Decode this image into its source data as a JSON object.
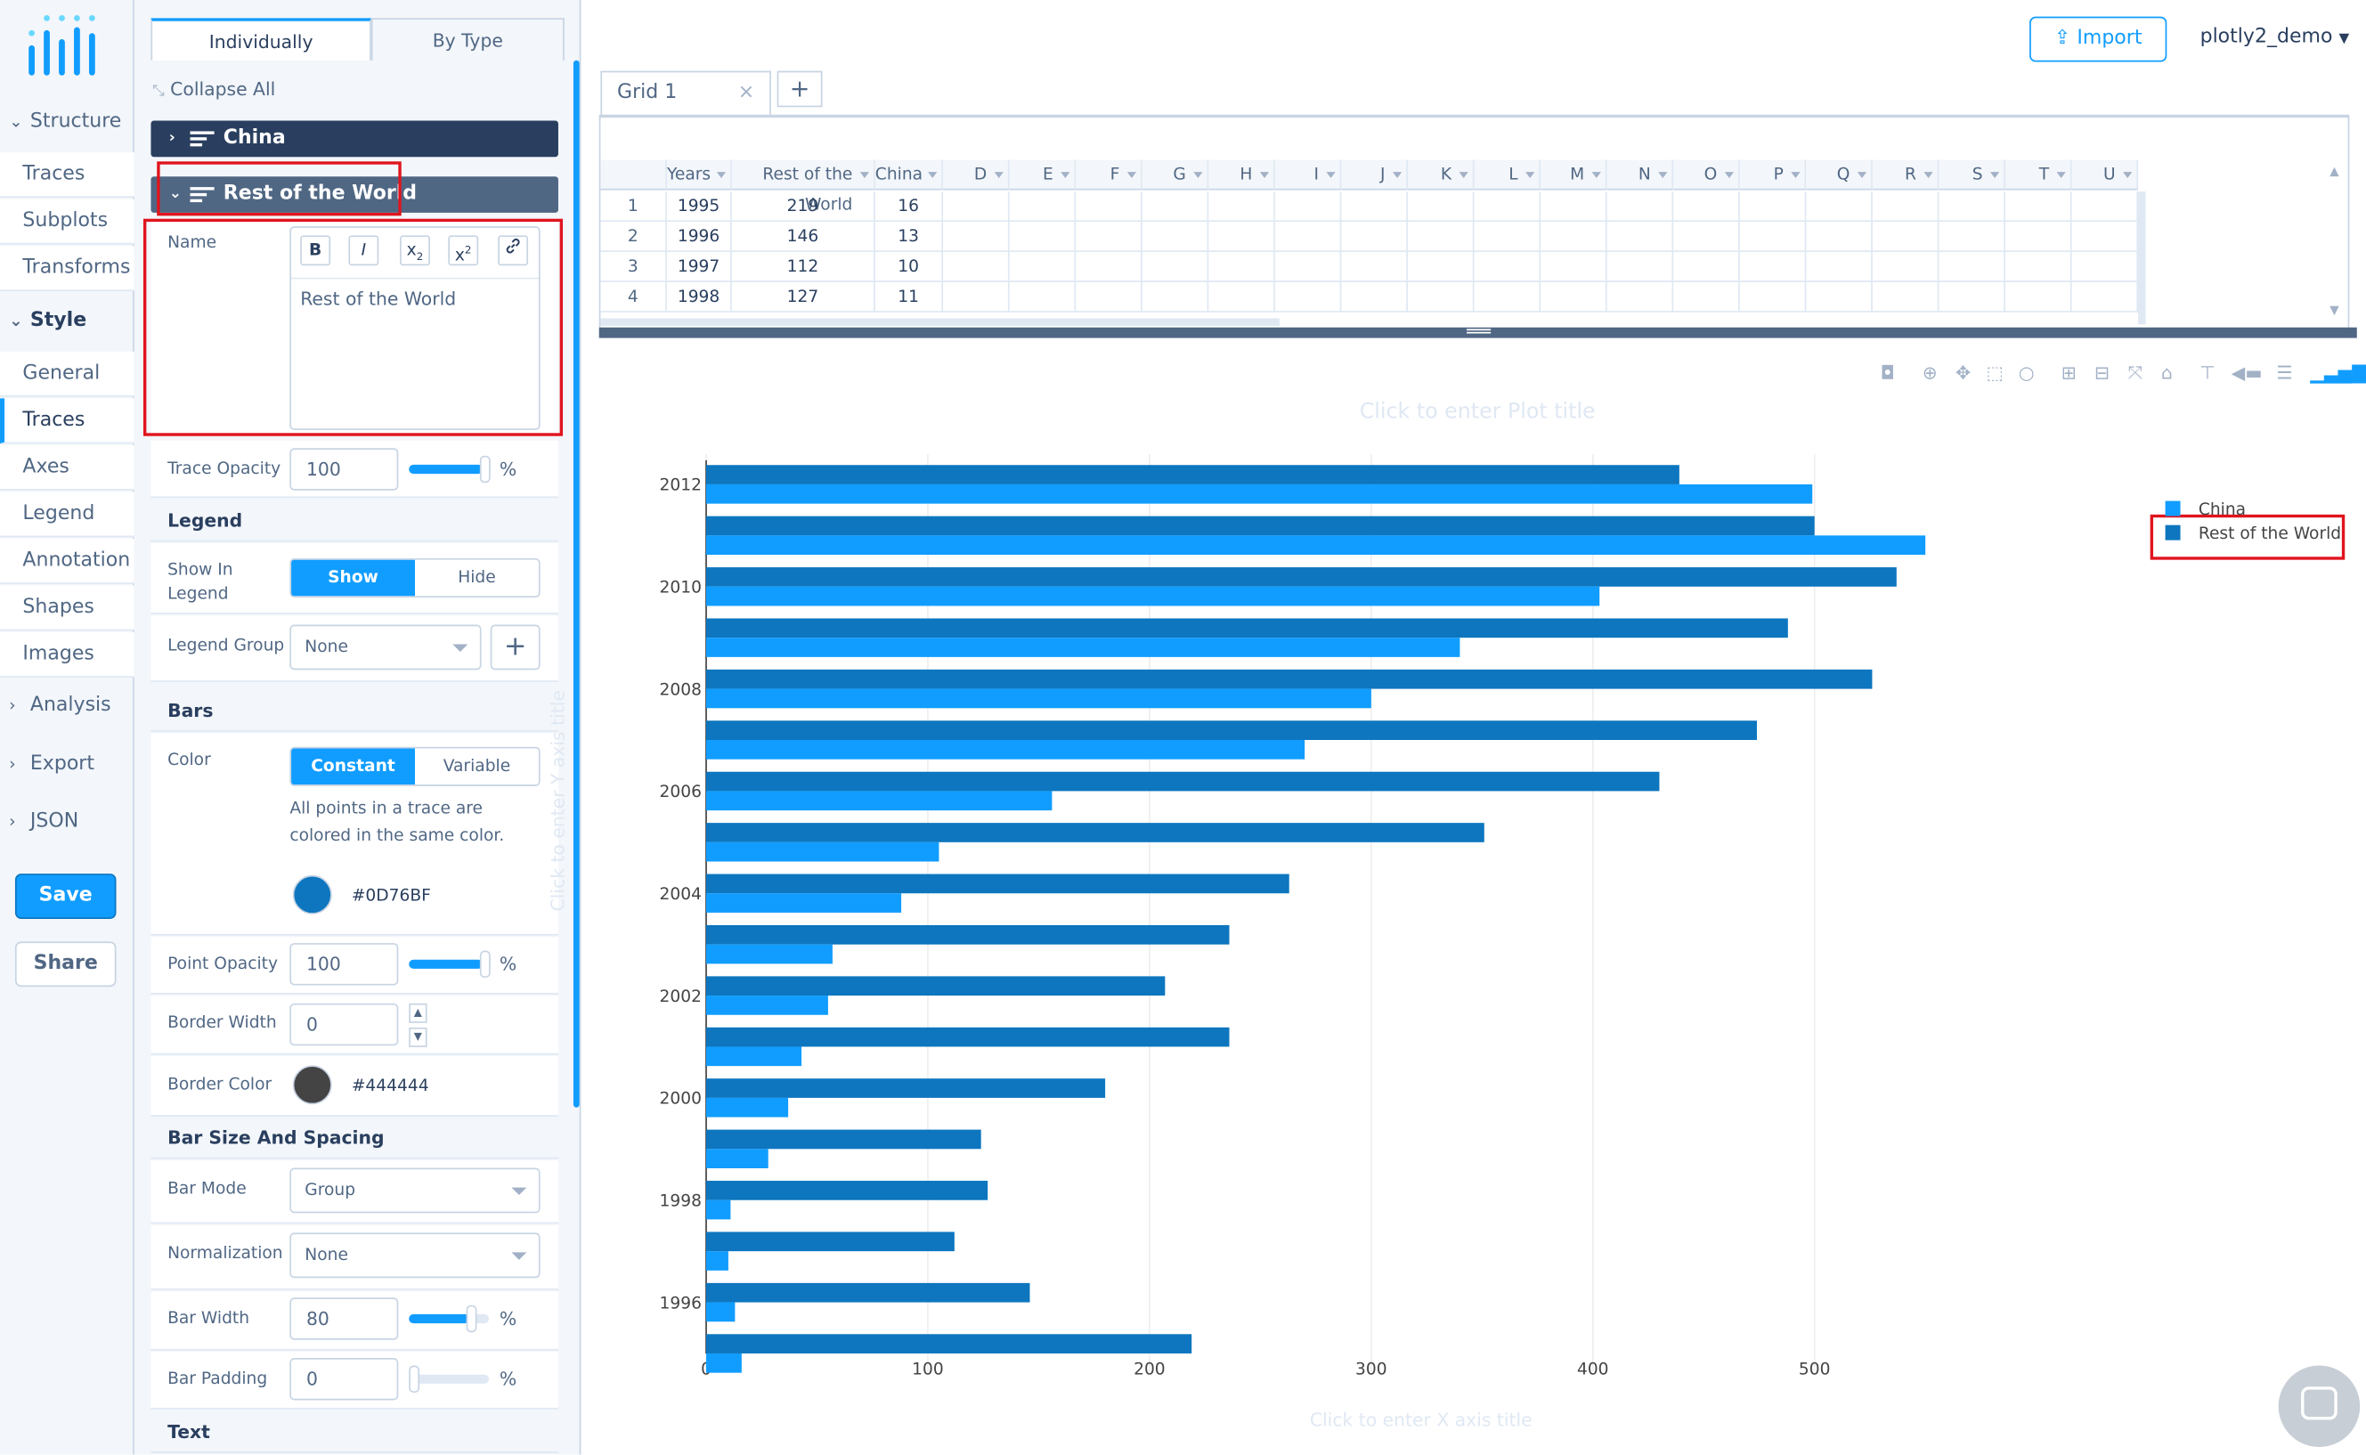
{
  "left_nav": {
    "structure_label": "Structure",
    "structure_items": [
      {
        "label": "Traces"
      },
      {
        "label": "Subplots"
      },
      {
        "label": "Transforms"
      }
    ],
    "style_label": "Style",
    "style_items": [
      {
        "label": "General"
      },
      {
        "label": "Traces"
      },
      {
        "label": "Axes"
      },
      {
        "label": "Legend"
      },
      {
        "label": "Annotation"
      },
      {
        "label": "Shapes"
      },
      {
        "label": "Images"
      }
    ],
    "analysis_label": "Analysis",
    "export_label": "Export",
    "json_label": "JSON",
    "save_label": "Save",
    "share_label": "Share"
  },
  "panel": {
    "tab_individually": "Individually",
    "tab_by_type": "By Type",
    "collapse_all": "Collapse All",
    "trace_china": "China",
    "trace_rest": "Rest of the World",
    "name_label": "Name",
    "fmt": {
      "bold": "B",
      "italic": "I",
      "sub": "x",
      "sub_s": "2",
      "sup": "x",
      "sup_s": "2"
    },
    "name_value": "Rest of the World",
    "trace_opacity_label": "Trace Opacity",
    "trace_opacity_value": "100",
    "percent": "%",
    "legend_section": "Legend",
    "show_in_legend_label": "Show In Legend",
    "show_label": "Show",
    "hide_label": "Hide",
    "legend_group_label": "Legend Group",
    "legend_group_value": "None",
    "bars_section": "Bars",
    "color_label": "Color",
    "constant_label": "Constant",
    "variable_label": "Variable",
    "color_help": "All points in a trace are colored in the same color.",
    "color_value": "#0D76BF",
    "point_opacity_label": "Point Opacity",
    "point_opacity_value": "100",
    "border_width_label": "Border Width",
    "border_width_value": "0",
    "border_color_label": "Border Color",
    "border_color_value": "#444444",
    "bar_size_section": "Bar Size And Spacing",
    "bar_mode_label": "Bar Mode",
    "bar_mode_value": "Group",
    "normalization_label": "Normalization",
    "normalization_value": "None",
    "bar_width_label": "Bar Width",
    "bar_width_value": "80",
    "bar_padding_label": "Bar Padding",
    "bar_padding_value": "0",
    "text_section": "Text"
  },
  "topbar": {
    "import_label": "Import",
    "user_label": "plotly2_demo"
  },
  "grid": {
    "tab_label": "Grid 1",
    "columns": [
      "Years",
      "Rest of the World",
      "China",
      "D",
      "E",
      "F",
      "G",
      "H",
      "I",
      "J",
      "K",
      "L",
      "M",
      "N",
      "O",
      "P",
      "Q",
      "R",
      "S",
      "T",
      "U"
    ],
    "rows": [
      {
        "n": "1",
        "year": "1995",
        "rest": "219",
        "china": "16"
      },
      {
        "n": "2",
        "year": "1996",
        "rest": "146",
        "china": "13"
      },
      {
        "n": "3",
        "year": "1997",
        "rest": "112",
        "china": "10"
      },
      {
        "n": "4",
        "year": "1998",
        "rest": "127",
        "china": "11"
      }
    ]
  },
  "plot": {
    "title_placeholder": "Click to enter Plot title",
    "x_title_placeholder": "Click to enter X axis title",
    "y_title_placeholder": "Click to enter Y axis title"
  },
  "colors": {
    "accent": "#119dff",
    "china": "#119dff",
    "rest": "#0d76bf",
    "sidebar_bg": "#f3f6fa",
    "trace_header": "#2a3f5f",
    "highlight": "#e0141e"
  },
  "chart_data": {
    "type": "bar",
    "orientation": "horizontal",
    "barmode": "group",
    "categories": [
      1995,
      1996,
      1997,
      1998,
      1999,
      2000,
      2001,
      2002,
      2003,
      2004,
      2005,
      2006,
      2007,
      2008,
      2009,
      2010,
      2011,
      2012
    ],
    "series": [
      {
        "name": "China",
        "color": "#119dff",
        "values": [
          16,
          13,
          10,
          11,
          28,
          37,
          43,
          55,
          57,
          88,
          105,
          156,
          270,
          300,
          340,
          403,
          550,
          499
        ]
      },
      {
        "name": "Rest of the World",
        "color": "#0d76bf",
        "values": [
          219,
          146,
          112,
          127,
          124,
          180,
          236,
          207,
          236,
          263,
          351,
          430,
          474,
          526,
          488,
          537,
          500,
          439
        ]
      }
    ],
    "xlim": [
      0,
      550
    ],
    "xticks": [
      0,
      100,
      200,
      300,
      400,
      500
    ],
    "yticks": [
      1996,
      1998,
      2000,
      2002,
      2004,
      2006,
      2008,
      2010,
      2012
    ],
    "legend_position": "top-right",
    "grid": true
  }
}
